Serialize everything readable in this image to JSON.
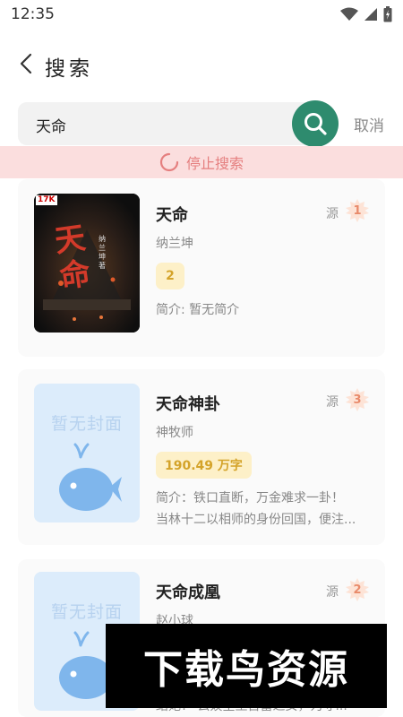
{
  "status": {
    "time": "12:35"
  },
  "header": {
    "title": "搜索"
  },
  "search": {
    "query": "天命",
    "cancel_label": "取消"
  },
  "stop_bar": {
    "label": "停止搜索"
  },
  "results": [
    {
      "title": "天命",
      "author": "纳兰坤",
      "word_count": "2",
      "intro": "简介: 暂无简介",
      "intro_2": "",
      "source_label": "源",
      "source_count": "1",
      "cover": {
        "type": "image",
        "logo_text": "17K",
        "title_glyph": "天命",
        "subtitle": "纳兰坤 著"
      }
    },
    {
      "title": "天命神卦",
      "author": "神牧师",
      "word_count": "190.49 万字",
      "intro": "简介：铁口直断，万金难求一卦！",
      "intro_2": "当林十二以相师的身份回国，便注...",
      "source_label": "源",
      "source_count": "3",
      "cover": {
        "type": "placeholder",
        "text": "暂无封面"
      }
    },
    {
      "title": "天命成凰",
      "author": "赵小球",
      "word_count": "",
      "intro": "结她！ 云娱呈至首富之女，为守...",
      "intro_2": "",
      "source_label": "源",
      "source_count": "2",
      "cover": {
        "type": "placeholder",
        "text": "暂无封面"
      }
    }
  ],
  "watermark": {
    "text": "下载鸟资源"
  },
  "colors": {
    "accent": "#2e8b6e",
    "stop_bar_bg": "#fbdede",
    "stop_text": "#e57f7f",
    "badge_bg": "#fdf0c8",
    "badge_text": "#d4a32a",
    "placeholder_bg": "#dcecfb",
    "placeholder_whale": "#7fb6ec"
  },
  "icons": {
    "wifi": "wifi-icon",
    "signal": "signal-icon",
    "battery": "battery-icon",
    "back": "chevron-left-icon",
    "search": "search-icon",
    "loading": "loading-spinner-icon",
    "source_badge": "starburst-icon",
    "whale": "whale-icon"
  }
}
